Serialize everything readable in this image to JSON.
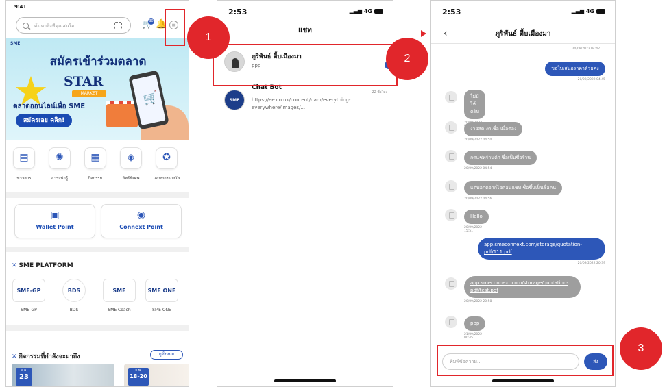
{
  "screen1": {
    "time": "9:41",
    "search_placeholder": "ค้นหาสิ่งที่คุณสนใจ",
    "cart_badge": "30",
    "banner": {
      "brand": "SME",
      "title": "สมัครเข้าร่วมตลาด",
      "logo_line1": "STAR",
      "logo_line2": "MARKET",
      "subtitle": "ตลาดออนไลน์เพื่อ SME",
      "cta": "สมัครเลย คลิก!"
    },
    "menu": [
      {
        "label": "ข่าวสาร",
        "icon": "news-icon",
        "glyph": "▤"
      },
      {
        "label": "สาระน่ารู้",
        "icon": "lightbulb-icon",
        "glyph": "✺"
      },
      {
        "label": "กิจกรรม",
        "icon": "calendar-icon",
        "glyph": "▦"
      },
      {
        "label": "สิทธิพิเศษ",
        "icon": "privilege-icon",
        "glyph": "◈"
      },
      {
        "label": "แลกของรางวัล",
        "icon": "reward-icon",
        "glyph": "✪"
      }
    ],
    "points": [
      {
        "label": "Wallet Point",
        "icon": "wallet-icon",
        "glyph": "▣"
      },
      {
        "label": "Connext Point",
        "icon": "points-icon",
        "glyph": "◉"
      }
    ],
    "platform": {
      "heading": "SME PLATFORM",
      "items": [
        {
          "logo": "SME-GP",
          "label": "SME-GP"
        },
        {
          "logo": "BDS",
          "label": "BDS"
        },
        {
          "logo": "SME",
          "label": "SME Coach"
        },
        {
          "logo": "SME ONE",
          "label": "SME ONE"
        }
      ]
    },
    "activities": {
      "heading": "กิจกรรมที่กำลังจะมาถึง",
      "see_all": "ดูทั้งหมด",
      "cards": [
        {
          "month": "ม.ค.",
          "day": "23"
        },
        {
          "month": "ก.พ.",
          "day": "18-20"
        }
      ]
    }
  },
  "screen2": {
    "time": "2:53",
    "network": "4G",
    "title": "แชท",
    "conversations": [
      {
        "name": "ภูริพันธ์ ตื้บเมืองมา",
        "last_message": "ppp",
        "time": ""
      },
      {
        "name": "Chat Bot",
        "last_message": "https://ee.co.uk/content/dam/everything-everywhere/images/...",
        "time": "22 ชั่วโมง",
        "avatar_text": "SME"
      }
    ]
  },
  "screen3": {
    "time": "2:53",
    "network": "4G",
    "title": "ภูริพันธ์ ตื้บเมืองมา",
    "top_timestamp": "20/09/2022 04:42",
    "messages": [
      {
        "dir": "out",
        "text": "ขอใบเสนอราคาด้วยค่ะ",
        "time": "20/09/2022 04:45"
      },
      {
        "dir": "in",
        "text": "ไม่มีให้ครับ",
        "time": "20/09/2022 04:49"
      },
      {
        "dir": "in",
        "text": "ง่ายสด งดเชื่อ เมื่อตอง",
        "time": "20/09/2022 04:50"
      },
      {
        "dir": "in",
        "text": "กดแชทร้านค้า ชื่อเป็นชื่อร้าน",
        "time": "20/09/2022 04:54"
      },
      {
        "dir": "in",
        "text": "แต่พอกดจากไอคอนแชท ชื่อขึ้นเป็นชื่อคน",
        "time": "20/09/2022 04:56"
      },
      {
        "dir": "in",
        "text": "Hello",
        "time": "20/09/2022 15:51"
      },
      {
        "dir": "out",
        "text": "app.smeconnext.com/storage/quotation-pdf/111.pdf",
        "time": "20/09/2022 20:39"
      },
      {
        "dir": "in",
        "text": "app.smeconnext.com/storage/quotation-pdf/test.pdf",
        "time": "20/09/2022 20:58"
      },
      {
        "dir": "in",
        "text": "ppp",
        "time": "21/09/2022 00:45"
      }
    ],
    "input_placeholder": "พิมพ์ข้อความ...",
    "send_label": "ส่ง"
  },
  "steps": [
    "1",
    "2",
    "3"
  ],
  "colors": {
    "accent": "#2d57b8",
    "highlight": "#e1262b"
  }
}
